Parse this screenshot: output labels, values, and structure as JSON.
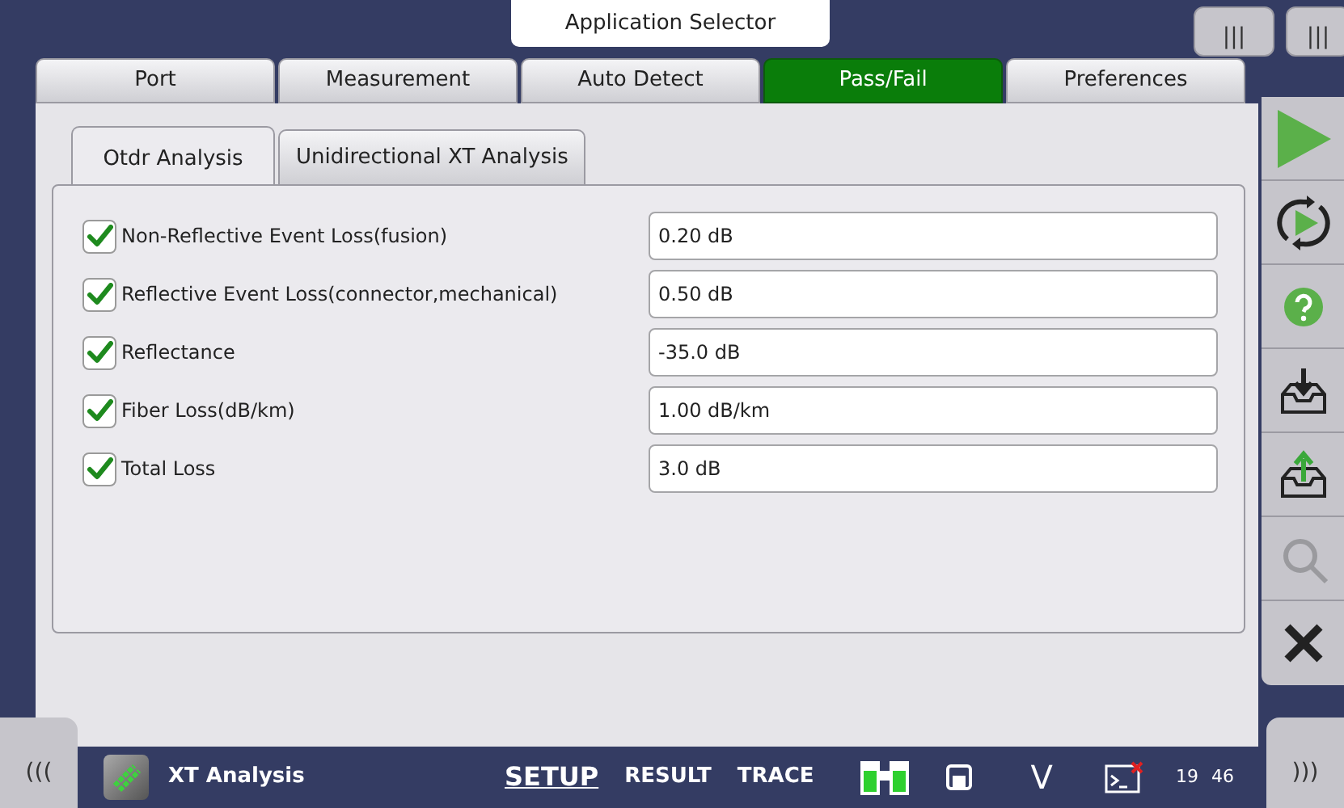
{
  "app_selector": {
    "title": "Application Selector"
  },
  "corner_tabs": [
    "|||",
    "|||"
  ],
  "tabs": [
    {
      "label": "Port",
      "selected": false
    },
    {
      "label": "Measurement",
      "selected": false
    },
    {
      "label": "Auto Detect",
      "selected": false
    },
    {
      "label": "Pass/Fail",
      "selected": true
    },
    {
      "label": "Preferences",
      "selected": false
    }
  ],
  "sub_tabs": [
    {
      "label": "Otdr Analysis",
      "selected": true
    },
    {
      "label": "Unidirectional XT Analysis",
      "selected": false
    }
  ],
  "rows": [
    {
      "label": "Non-Reflective Event Loss(fusion)",
      "checked": true,
      "value": "0.20 dB"
    },
    {
      "label": "Reflective Event Loss(connector,mechanical)",
      "checked": true,
      "value": "0.50 dB"
    },
    {
      "label": "Reflectance",
      "checked": true,
      "value": "-35.0 dB"
    },
    {
      "label": "Fiber Loss(dB/km)",
      "checked": true,
      "value": "1.00 dB/km"
    },
    {
      "label": "Total Loss",
      "checked": true,
      "value": "3.0 dB"
    }
  ],
  "taskbar": {
    "left_handle": "(((",
    "app_name": "XT Analysis",
    "views": [
      {
        "label": "SETUP",
        "selected": true
      },
      {
        "label": "RESULT",
        "selected": false
      },
      {
        "label": "TRACE",
        "selected": false
      }
    ],
    "status_letter": "V",
    "clock": [
      "19",
      "46"
    ],
    "right_handle": ")))"
  }
}
